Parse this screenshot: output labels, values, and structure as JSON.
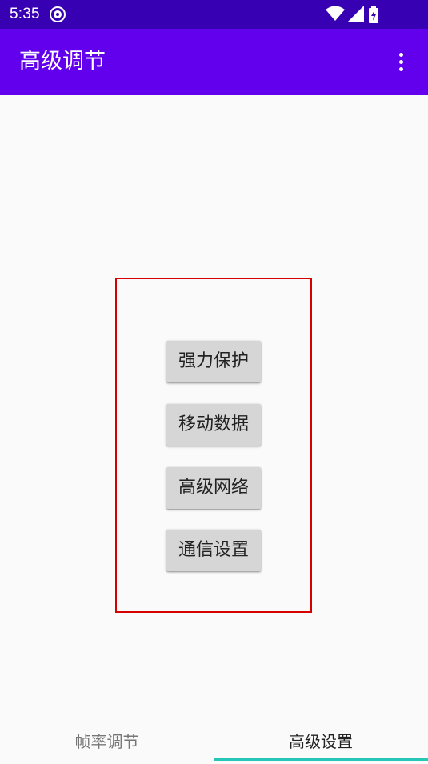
{
  "status_bar": {
    "time": "5:35",
    "left_icon": "shield-icon",
    "right_icons": [
      "wifi-icon",
      "signal-icon",
      "battery-charging-icon"
    ]
  },
  "app_bar": {
    "title": "高级调节",
    "menu_icon": "more-vert-icon"
  },
  "buttons": [
    {
      "label": "强力保护"
    },
    {
      "label": "移动数据"
    },
    {
      "label": "高级网络"
    },
    {
      "label": "通信设置"
    }
  ],
  "bottom_nav": {
    "tabs": [
      {
        "label": "帧率调节",
        "selected": false
      },
      {
        "label": "高级设置",
        "selected": true
      }
    ]
  },
  "colors": {
    "status_bar": "#3700b3",
    "app_bar": "#6200ee",
    "highlight_border": "#d60000",
    "tab_indicator": "#26c6b8",
    "button_bg": "#d6d6d6"
  }
}
